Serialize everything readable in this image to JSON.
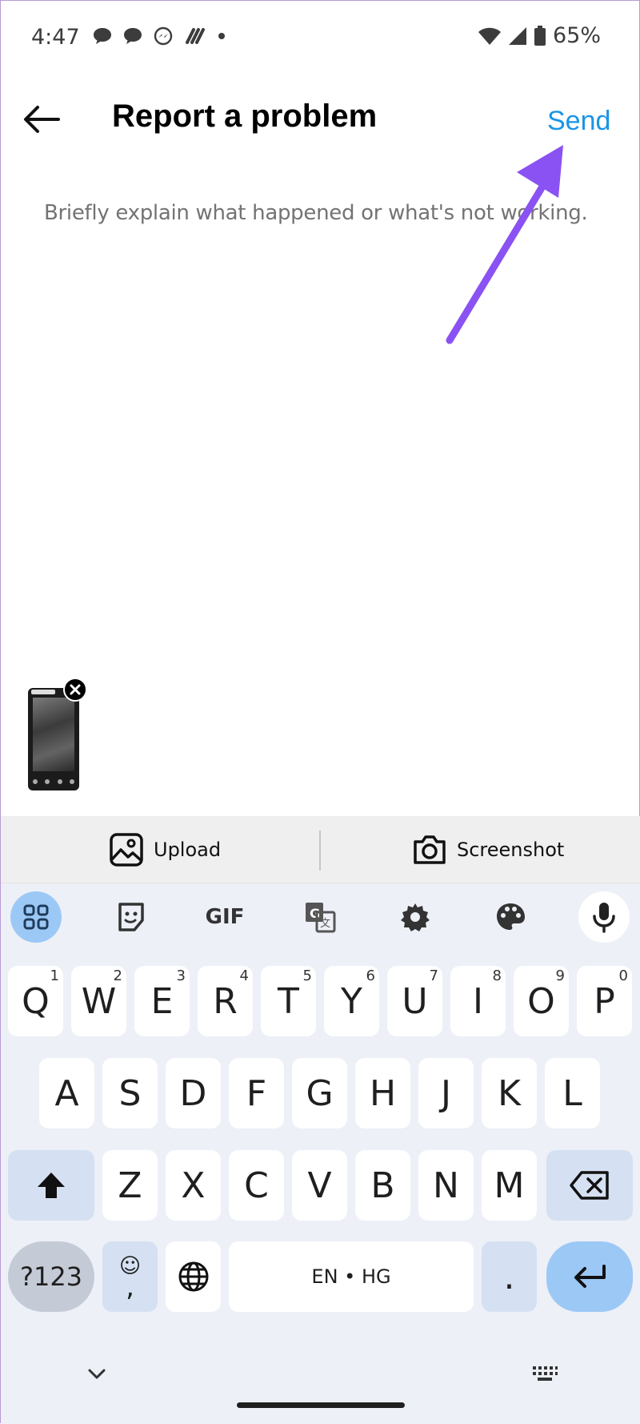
{
  "status_bar": {
    "time": "4:47",
    "battery": "65%",
    "icons_left": [
      "chat-bubble-icon",
      "chat-bubble-icon",
      "messenger-icon",
      "slack-icon",
      "dot-icon"
    ],
    "icons_right": [
      "wifi-icon",
      "cell-signal-icon",
      "battery-icon"
    ]
  },
  "header": {
    "title": "Report a problem",
    "send_label": "Send"
  },
  "description": {
    "placeholder": "Briefly explain what happened or what's not working."
  },
  "attachments": {
    "upload_label": "Upload",
    "screenshot_label": "Screenshot"
  },
  "keyboard": {
    "row1": [
      {
        "label": "Q",
        "hint": "1"
      },
      {
        "label": "W",
        "hint": "2"
      },
      {
        "label": "E",
        "hint": "3"
      },
      {
        "label": "R",
        "hint": "4"
      },
      {
        "label": "T",
        "hint": "5"
      },
      {
        "label": "Y",
        "hint": "6"
      },
      {
        "label": "U",
        "hint": "7"
      },
      {
        "label": "I",
        "hint": "8"
      },
      {
        "label": "O",
        "hint": "9"
      },
      {
        "label": "P",
        "hint": "0"
      }
    ],
    "row2": [
      "A",
      "S",
      "D",
      "F",
      "G",
      "H",
      "J",
      "K",
      "L"
    ],
    "row3": [
      "Z",
      "X",
      "C",
      "V",
      "B",
      "N",
      "M"
    ],
    "symbols_label": "?123",
    "emoji_label": "☺",
    "comma_label": ",",
    "space_label": "EN • HG",
    "period_label": ".",
    "gif_label": "GIF"
  },
  "colors": {
    "accent": "#1a95e6",
    "annotation_arrow": "#8a52f2",
    "keyboard_bg": "#edf0f7",
    "modifier_key": "#d5e1f2",
    "enter_key": "#9cc8f6"
  }
}
